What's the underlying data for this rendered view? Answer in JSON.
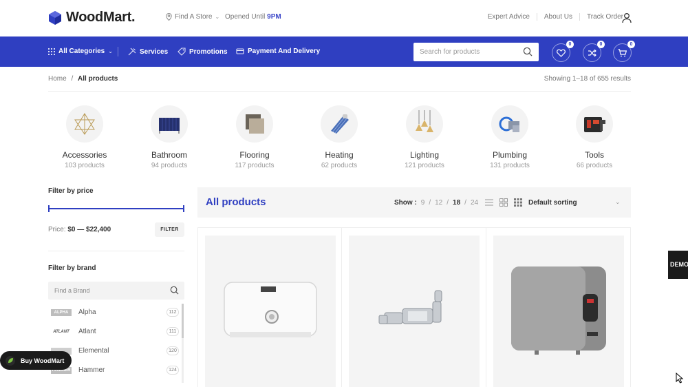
{
  "header": {
    "logo_text": "WoodMart.",
    "find_store": "Find A Store",
    "opened_label": "Opened Until",
    "opened_time": "9PM",
    "links": [
      "Expert Advice",
      "About Us",
      "Track Order"
    ],
    "user_icon": "user-icon"
  },
  "nav": {
    "all_categories": "All Categories",
    "services": "Services",
    "promotions": "Promotions",
    "payment": "Payment And Delivery",
    "search_placeholder": "Search for products",
    "wishlist_count": "0",
    "compare_count": "0",
    "cart_count": "0",
    "accent": "#2f3fc1"
  },
  "breadcrumb": {
    "home": "Home",
    "separator": "/",
    "current": "All products",
    "results": "Showing 1–18 of 655 results"
  },
  "categories": [
    {
      "name": "Accessories",
      "count": "103 products"
    },
    {
      "name": "Bathroom",
      "count": "94 products"
    },
    {
      "name": "Flooring",
      "count": "117 products"
    },
    {
      "name": "Heating",
      "count": "62 products"
    },
    {
      "name": "Lighting",
      "count": "121 products"
    },
    {
      "name": "Plumbing",
      "count": "131 products"
    },
    {
      "name": "Tools",
      "count": "66 products"
    }
  ],
  "sidebar": {
    "price_title": "Filter by price",
    "price_label": "Price:",
    "price_min": "$0",
    "price_dash": "—",
    "price_max": "$22,400",
    "filter_button": "FILTER",
    "brand_title": "Filter by brand",
    "brand_placeholder": "Find a Brand",
    "brands": [
      {
        "name": "Alpha",
        "count": "112",
        "logo": "ALPHA"
      },
      {
        "name": "Atlant",
        "count": "111",
        "logo": "ATLANT"
      },
      {
        "name": "Elemental",
        "count": "120",
        "logo": ""
      },
      {
        "name": "Hammer",
        "count": "124",
        "logo": "HAMMER"
      }
    ]
  },
  "buy_button": "Buy WoodMart",
  "main": {
    "title": "All products",
    "show_label": "Show :",
    "show_options": [
      "9",
      "12",
      "18",
      "24"
    ],
    "show_active": "18",
    "sorting": "Default sorting"
  },
  "demo_tab": "DEMO"
}
